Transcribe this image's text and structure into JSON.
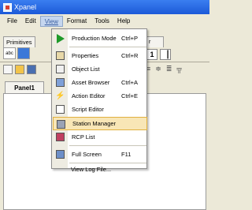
{
  "window": {
    "title": "Xpanel"
  },
  "menubar": {
    "items": [
      "File",
      "Edit",
      "View",
      "Format",
      "Tools",
      "Help"
    ]
  },
  "toolbar": {
    "tab_primitives": "Primitives",
    "tab_right_fragment": "r",
    "field_label": "abc",
    "right_value": "1"
  },
  "panel": {
    "tab_label": "Panel1"
  },
  "view_menu": {
    "items": [
      {
        "label": "Production Mode",
        "shortcut": "Ctrl+P",
        "icon": "play-icon"
      },
      {
        "label": "Properties",
        "shortcut": "Ctrl+R",
        "icon": "properties-icon"
      },
      {
        "label": "Object List",
        "shortcut": "",
        "icon": "object-list-icon"
      },
      {
        "label": "Asset Browser",
        "shortcut": "Ctrl+A",
        "icon": "asset-browser-icon"
      },
      {
        "label": "Action Editor",
        "shortcut": "Ctrl+E",
        "icon": "action-editor-icon"
      },
      {
        "label": "Script Editor",
        "shortcut": "",
        "icon": "script-editor-icon"
      },
      {
        "label": "Station Manager",
        "shortcut": "",
        "icon": "station-manager-icon",
        "highlighted": true
      },
      {
        "label": "RCP List",
        "shortcut": "",
        "icon": "rcp-list-icon"
      },
      {
        "label": "Full Screen",
        "shortcut": "F11",
        "icon": "full-screen-icon"
      },
      {
        "label": "View Log File...",
        "shortcut": "",
        "icon": ""
      }
    ]
  },
  "colors": {
    "titlebar": "#1c5ad8",
    "menu_highlight": "#f8e6b6",
    "play_green": "#1e9a2a"
  }
}
